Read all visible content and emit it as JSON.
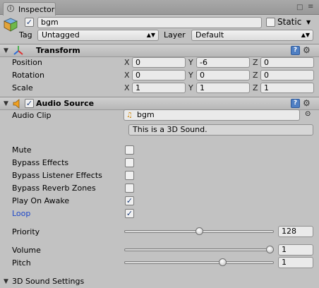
{
  "window": {
    "tab_title": "Inspector",
    "tab_icon": "i"
  },
  "gameobject": {
    "name": "bgm",
    "active": true,
    "static_label": "Static",
    "static_checked": false,
    "tag_label": "Tag",
    "tag_value": "Untagged",
    "layer_label": "Layer",
    "layer_value": "Default"
  },
  "transform": {
    "title": "Transform",
    "rows": [
      {
        "label": "Position",
        "x": "0",
        "y": "-6",
        "z": "0"
      },
      {
        "label": "Rotation",
        "x": "0",
        "y": "0",
        "z": "0"
      },
      {
        "label": "Scale",
        "x": "1",
        "y": "1",
        "z": "1"
      }
    ],
    "axis_x": "X",
    "axis_y": "Y",
    "axis_z": "Z"
  },
  "audio_source": {
    "title": "Audio Source",
    "enabled": true,
    "audio_clip_label": "Audio Clip",
    "audio_clip_value": "bgm",
    "info_text": "This is a 3D Sound.",
    "toggles": [
      {
        "label": "Mute",
        "checked": false
      },
      {
        "label": "Bypass Effects",
        "checked": false
      },
      {
        "label": "Bypass Listener Effects",
        "checked": false
      },
      {
        "label": "Bypass Reverb Zones",
        "checked": false
      },
      {
        "label": "Play On Awake",
        "checked": true
      },
      {
        "label": "Loop",
        "checked": true
      }
    ],
    "priority": {
      "label": "Priority",
      "value": "128",
      "fraction": 0.5
    },
    "volume": {
      "label": "Volume",
      "value": "1",
      "fraction": 1.0
    },
    "pitch": {
      "label": "Pitch",
      "value": "1",
      "fraction": 0.6667
    },
    "sound3d_label": "3D Sound Settings"
  },
  "colors": {
    "loop_label": "#1d47c8",
    "check_mark": "#1e3e7a"
  }
}
